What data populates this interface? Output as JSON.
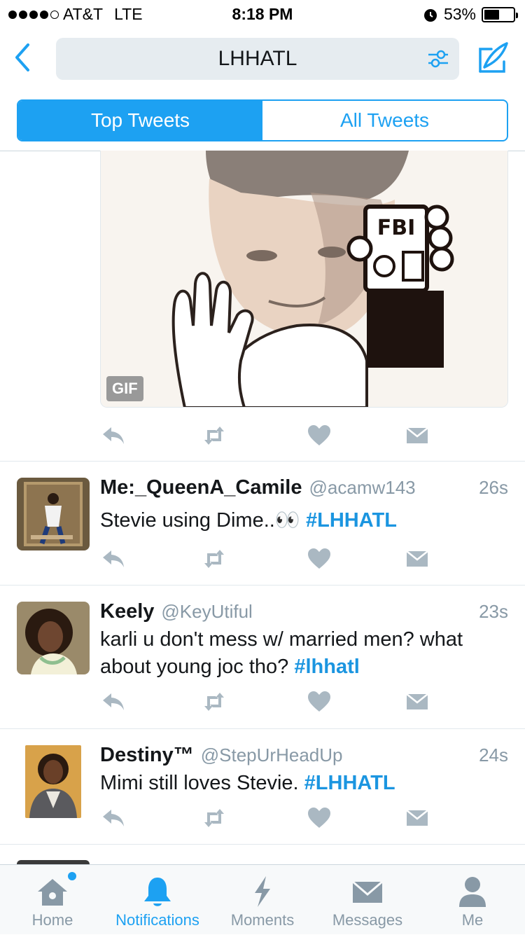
{
  "status_bar": {
    "carrier": "AT&T",
    "network": "LTE",
    "time": "8:18 PM",
    "battery": "53%",
    "battery_level": 0.53
  },
  "search": {
    "query": "LHHATL"
  },
  "segments": [
    {
      "label": "Top Tweets",
      "active": true
    },
    {
      "label": "All Tweets",
      "active": false
    }
  ],
  "media": {
    "badge": "GIF",
    "sign_text": "FBI"
  },
  "tweets": [
    {
      "name": "Me:_QueenA_Camile",
      "handle": "@acamw143",
      "time": "26s",
      "text_before": "Stevie using Dime..👀 ",
      "hashtag": "#LHHATL"
    },
    {
      "name": "Keely",
      "handle": "@KeyUtiful",
      "time": "23s",
      "text_before": "karli u don't mess w/ married men? what about young joc tho? ",
      "hashtag": "#lhhatl"
    },
    {
      "name": "Destiny™",
      "handle": "@StepUrHeadUp",
      "time": "24s",
      "text_before": "Mimi still loves Stevie. ",
      "hashtag": "#LHHATL"
    }
  ],
  "tabbar": [
    {
      "label": "Home",
      "icon": "home-icon",
      "active": false
    },
    {
      "label": "Notifications",
      "icon": "bell-icon",
      "active": true
    },
    {
      "label": "Moments",
      "icon": "lightning-icon",
      "active": false
    },
    {
      "label": "Messages",
      "icon": "envelope-icon",
      "active": false
    },
    {
      "label": "Me",
      "icon": "person-icon",
      "active": false
    }
  ],
  "colors": {
    "accent": "#1da1f2",
    "hashtag": "#1b95e0",
    "gray": "#8899a6",
    "icon_gray": "#aab8c2"
  }
}
